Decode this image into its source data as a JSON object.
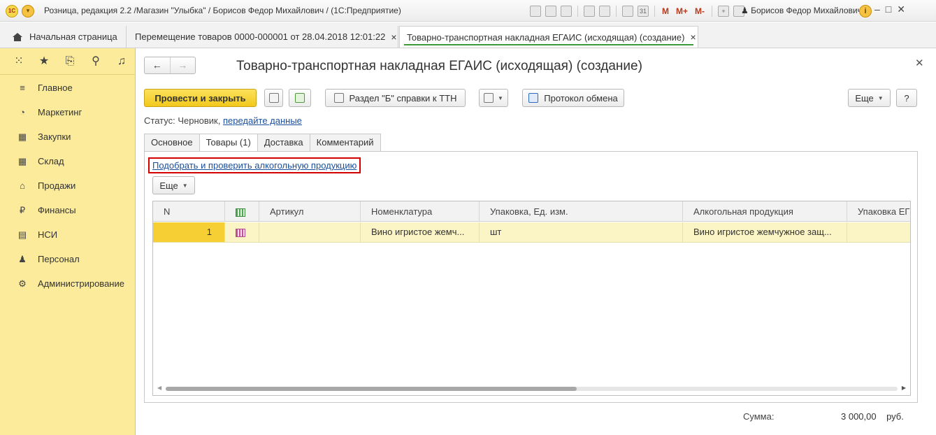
{
  "window": {
    "logo": "1С",
    "title": "Розница, редакция 2.2 /Магазин \"Улыбка\" / Борисов Федор Михайлович / (1С:Предприятие)",
    "toolbar_icons": [
      "save-icon",
      "print-icon",
      "preview-icon",
      "upload-icon",
      "print-file-icon",
      "calculator-icon",
      "calendar-icon"
    ],
    "calendar_num": "31",
    "memory_buttons": [
      "M",
      "M+",
      "M-"
    ],
    "user": "Борисов Федор Михайлович",
    "info": "i",
    "controls": [
      "‒",
      "□",
      "✕"
    ]
  },
  "tabs": [
    {
      "label": "Начальная страница"
    },
    {
      "label": "Перемещение товаров 0000-000001 от 28.04.2018 12:01:22"
    },
    {
      "label": "Товарно-транспортная накладная ЕГАИС (исходящая) (создание)"
    }
  ],
  "sidebar": {
    "top_icons": [
      "apps-grid-icon",
      "star-icon",
      "history-icon",
      "search-icon",
      "bell-icon"
    ],
    "items": [
      {
        "label": "Главное",
        "icon": "menu-lines-icon"
      },
      {
        "label": "Маркетинг",
        "icon": "pie-chart-icon"
      },
      {
        "label": "Закупки",
        "icon": "cart-icon"
      },
      {
        "label": "Склад",
        "icon": "warehouse-icon"
      },
      {
        "label": "Продажи",
        "icon": "basket-icon"
      },
      {
        "label": "Финансы",
        "icon": "ruble-icon"
      },
      {
        "label": "НСИ",
        "icon": "reference-icon"
      },
      {
        "label": "Персонал",
        "icon": "person-icon"
      },
      {
        "label": "Администрирование",
        "icon": "gear-icon"
      }
    ]
  },
  "form": {
    "title": "Товарно-транспортная накладная ЕГАИС (исходящая) (создание)",
    "post_close": "Провести и закрыть",
    "section_b": "Раздел \"Б\" справки к ТТН",
    "exchange_log": "Протокол обмена",
    "more": "Еще",
    "help": "?",
    "status_label": "Статус:",
    "status_value": "Черновик,",
    "status_link": "передайте данные",
    "tabs": [
      "Основное",
      "Товары (1)",
      "Доставка",
      "Комментарий"
    ],
    "pick_link": "Подобрать и проверить алкогольную продукцию",
    "grid_more": "Еще"
  },
  "table": {
    "columns": [
      "N",
      "",
      "Артикул",
      "Номенклатура",
      "Упаковка, Ед. изм.",
      "Алкогольная продукция",
      "Упаковка ЕГ"
    ],
    "rows": [
      {
        "n": "1",
        "article": "",
        "nomenclature": "Вино игристое жемч...",
        "unit": "шт",
        "alcohol": "Вино игристое жемчужное защ..."
      }
    ]
  },
  "totals": {
    "label": "Сумма:",
    "value": "3 000,00",
    "currency": "руб."
  }
}
